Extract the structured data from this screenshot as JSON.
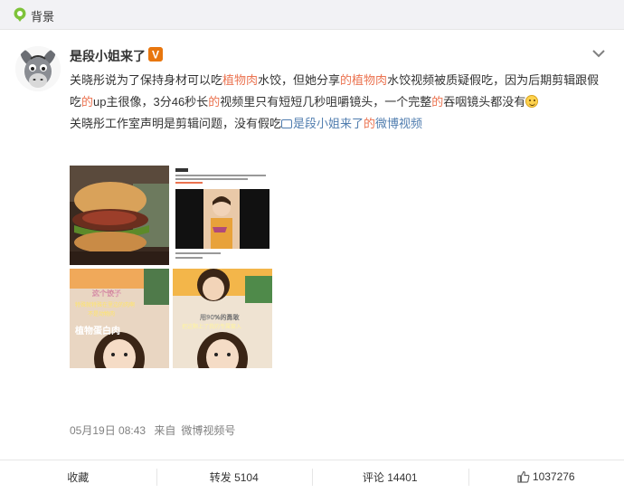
{
  "topbar": {
    "label": "背景"
  },
  "post": {
    "username": "是段小姐来了",
    "vip_badge": "V",
    "text_segments": {
      "s1": "关晓彤说为了保持身材可以吃",
      "s2": "植物肉",
      "s3": "水饺，但她分享",
      "s4": "的植物肉",
      "s5": "水饺视频被质疑假吃，因为后期剪辑跟假吃",
      "s6": "的",
      "s7": "up主很像，3分46秒长",
      "s8": "的",
      "s9": "视频里只有短短几秒咀嚼镜头，一个完整",
      "s10": "的",
      "s11": "吞咽镜头都没有",
      "s12": "关晓彤工作室声明是剪辑问题，没有假吃",
      "link": "是段小姐来了",
      "link_suffix_red": "的",
      "link_suffix_blue": "微博视频"
    },
    "images": {
      "tile2_caption": "视频里没有咀嚼",
      "tile3_line1": "这个饺子",
      "tile3_line2": "特殊就特殊在里边的肉啊",
      "tile3_line3": "不是动物肉",
      "tile3_line4": "植物蛋白肉",
      "tile4_line1": "用90%的勇敢",
      "tile4_line2": "把这颗上了我的专属套入"
    },
    "timestamp": "05月19日 08:43",
    "source_prefix": "来自",
    "source": "微博视频号"
  },
  "actions": {
    "favorite": "收藏",
    "repost": "转发 5104",
    "comment": "评论 14401",
    "like_count": "1037276"
  },
  "colors": {
    "highlight": "#eb7350",
    "link": "#507daf",
    "badge": "#e8760e"
  }
}
